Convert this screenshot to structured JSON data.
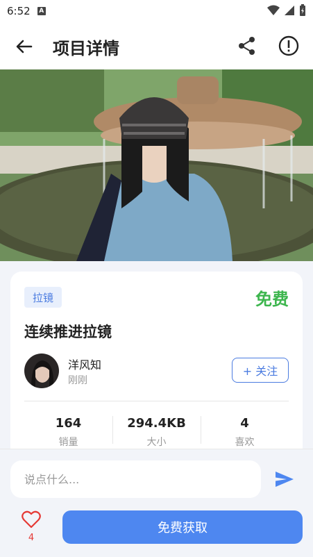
{
  "status_bar": {
    "time": "6:52",
    "notification_icon": "A"
  },
  "header": {
    "title": "项目详情",
    "back_icon": "arrow-left",
    "share_icon": "share",
    "info_icon": "exclamation-circle"
  },
  "hero": {
    "description_icon": "photo"
  },
  "card": {
    "tag": "拉镜",
    "price": "免费",
    "title": "连续推进拉镜",
    "author": {
      "name": "洋风知",
      "time": "刚刚"
    },
    "follow_label": "+ 关注",
    "stats": [
      {
        "value": "164",
        "label": "销量"
      },
      {
        "value": "294.4KB",
        "label": "大小"
      },
      {
        "value": "4",
        "label": "喜欢"
      }
    ]
  },
  "bottom": {
    "comment_placeholder": "说点什么...",
    "like_count": "4",
    "get_button": "免费获取"
  },
  "colors": {
    "accent": "#4e87f0",
    "price": "#3db64e",
    "like": "#e53935"
  }
}
